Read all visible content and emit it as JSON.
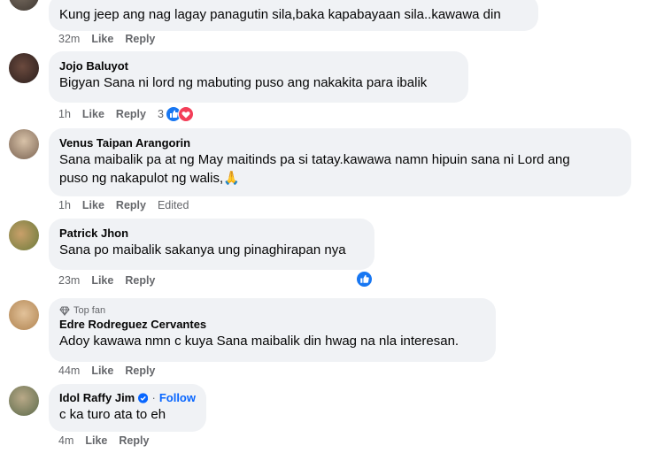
{
  "comments": [
    {
      "text": "Kung jeep ang nag lagay panagutin sila,baka kapabayaan sila..kawawa din",
      "time": "32m",
      "like": "Like",
      "reply": "Reply"
    },
    {
      "name": "Jojo Baluyot",
      "text": "Bigyan Sana ni lord ng mabuting puso ang nakakita para ibalik",
      "time": "1h",
      "like": "Like",
      "reply": "Reply",
      "reaction_count": "3",
      "reactions": [
        "like-reaction",
        "love-reaction"
      ]
    },
    {
      "name": "Venus Taipan Arangorin",
      "text_line1": "Sana maibalik pa at ng May maitinds pa si tatay.kawawa namn hipuin sana ni Lord ang",
      "text_line2": "puso ng nakapulot ng walis,🙏",
      "time": "1h",
      "like": "Like",
      "reply": "Reply",
      "edited": "Edited"
    },
    {
      "name": "Patrick Jhon",
      "text": "Sana po maibalik sakanya ung pinaghirapan nya",
      "time": "23m",
      "like": "Like",
      "reply": "Reply",
      "reactions": [
        "like-reaction"
      ]
    },
    {
      "badge": "Top fan",
      "name": "Edre Rodreguez Cervantes",
      "text": "Adoy kawawa nmn c kuya Sana maibalik din hwag na nla interesan.",
      "time": "44m",
      "like": "Like",
      "reply": "Reply"
    },
    {
      "name": "Idol Raffy Jim",
      "follow": "Follow",
      "separator": "·",
      "text": "c ka turo ata to eh",
      "time": "4m",
      "like": "Like",
      "reply": "Reply"
    }
  ],
  "colors": {
    "bubble": "#f0f2f5",
    "meta": "#65676b",
    "link": "#0866ff",
    "like": "#1877f2",
    "love": "#f33e58"
  }
}
